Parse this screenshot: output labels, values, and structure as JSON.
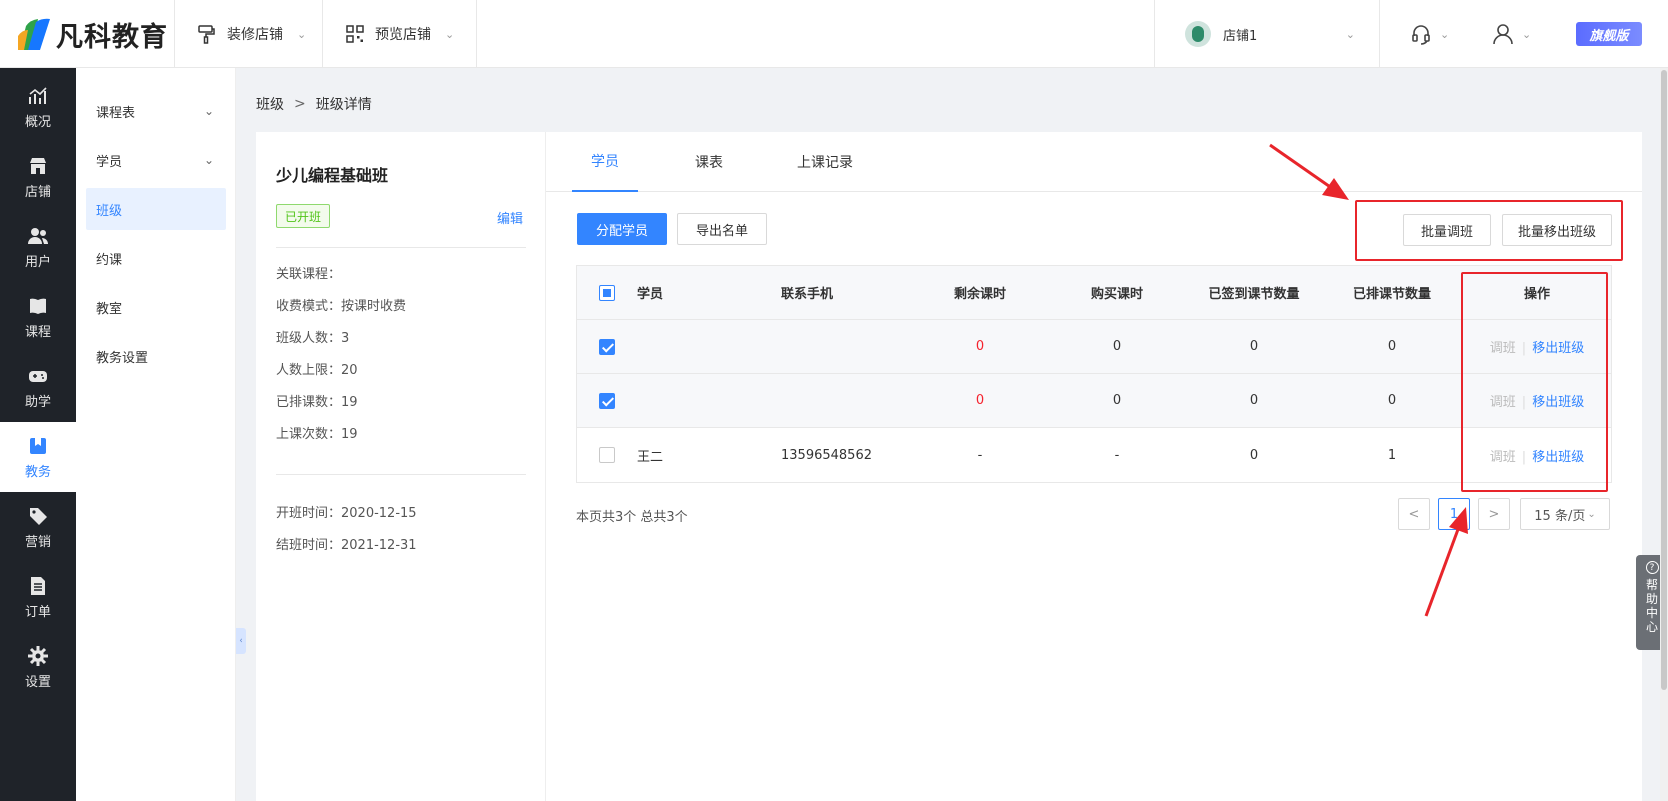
{
  "header": {
    "logo_text": "凡科教育",
    "decorate_store": "装修店铺",
    "preview_store": "预览店铺",
    "store_name": "店铺1",
    "vip_badge": "旗舰版"
  },
  "leftnav": {
    "items": [
      {
        "label": "概况",
        "icon": "chart-icon"
      },
      {
        "label": "店铺",
        "icon": "store-icon"
      },
      {
        "label": "用户",
        "icon": "users-icon"
      },
      {
        "label": "课程",
        "icon": "book-icon"
      },
      {
        "label": "助学",
        "icon": "gamepad-icon"
      },
      {
        "label": "教务",
        "icon": "bookmark-icon",
        "active": true
      },
      {
        "label": "营销",
        "icon": "tag-icon"
      },
      {
        "label": "订单",
        "icon": "document-icon"
      },
      {
        "label": "设置",
        "icon": "gear-icon"
      }
    ]
  },
  "subnav": {
    "items": [
      {
        "label": "课程表",
        "expandable": true
      },
      {
        "label": "学员",
        "expandable": true
      },
      {
        "label": "班级",
        "active": true
      },
      {
        "label": "约课"
      },
      {
        "label": "教室"
      },
      {
        "label": "教务设置"
      }
    ]
  },
  "breadcrumb": {
    "parent": "班级",
    "separator": ">",
    "current": "班级详情"
  },
  "class_info": {
    "name": "少儿编程基础班",
    "status": "已开班",
    "edit_label": "编辑",
    "rows": [
      "关联课程：",
      "收费模式：按课时收费",
      "班级人数：3",
      "人数上限：20",
      "已排课数：19",
      "上课次数：19"
    ],
    "dates": [
      "开班时间：2020-12-15",
      "结班时间：2021-12-31"
    ]
  },
  "tabs": [
    "学员",
    "课表",
    "上课记录"
  ],
  "toolbar": {
    "assign": "分配学员",
    "export": "导出名单",
    "batch_transfer": "批量调班",
    "batch_remove": "批量移出班级"
  },
  "table": {
    "headers": [
      "学员",
      "联系手机",
      "剩余课时",
      "购买课时",
      "已签到课节数量",
      "已排课节数量",
      "操作"
    ],
    "rows": [
      {
        "name": "",
        "phone": "",
        "remaining": "0",
        "purchased": "0",
        "signed": "0",
        "scheduled": "0",
        "checked": true
      },
      {
        "name": "",
        "phone": "",
        "remaining": "0",
        "purchased": "0",
        "signed": "0",
        "scheduled": "0",
        "checked": true
      },
      {
        "name": "王二",
        "phone": "13596548562",
        "remaining": "-",
        "purchased": "-",
        "signed": "0",
        "scheduled": "1",
        "checked": false
      }
    ],
    "op_transfer": "调班",
    "op_remove": "移出班级"
  },
  "pagination": {
    "summary": "本页共3个 总共3个",
    "prev": "<",
    "current": "1",
    "next": ">",
    "page_size": "15 条/页"
  },
  "help": {
    "label_chars": [
      "帮",
      "助",
      "中",
      "心"
    ]
  },
  "colors": {
    "accent": "#3385ff",
    "sidebar_bg": "#1f2329",
    "danger": "#f5222d",
    "annotation": "#e8252b",
    "success": "#52c41a"
  }
}
